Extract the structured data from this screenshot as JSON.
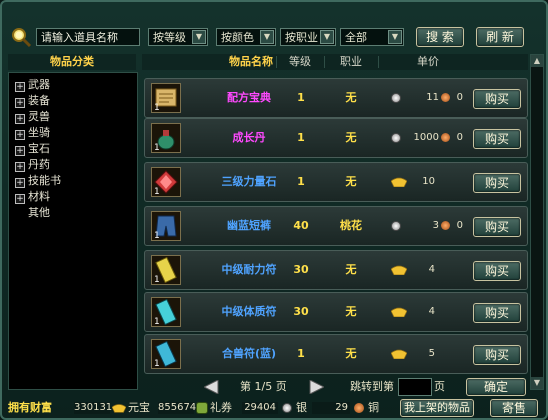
{
  "search": {
    "placeholder": "请输入道具名称"
  },
  "filters": {
    "level": "按等级",
    "color": "按颜色",
    "profession": "按职业",
    "scope": "全部"
  },
  "buttons": {
    "search": "搜 索",
    "refresh": "刷 新",
    "confirm": "确定",
    "my_listed": "我上架的物品",
    "sell": "寄售"
  },
  "category": {
    "header": "物品分类",
    "items": [
      {
        "label": "武器",
        "expand": "+"
      },
      {
        "label": "装备",
        "expand": "+"
      },
      {
        "label": "灵兽",
        "expand": "+"
      },
      {
        "label": "坐骑",
        "expand": "+"
      },
      {
        "label": "宝石",
        "expand": "+"
      },
      {
        "label": "丹药",
        "expand": "+"
      },
      {
        "label": "技能书",
        "expand": "+"
      },
      {
        "label": "材料",
        "expand": "+"
      },
      {
        "label": "其他",
        "expand": ""
      }
    ]
  },
  "table": {
    "headers": {
      "name": "物品名称",
      "level": "等级",
      "profession": "职业",
      "price": "单价"
    },
    "rows": [
      {
        "name": "配方宝典",
        "name_color": "#ff49ff",
        "level": "1",
        "profession": "无",
        "currency": "silver",
        "price_main": "11",
        "price_copper": "0",
        "count": "1",
        "icon": "scroll-book-icon"
      },
      {
        "name": "成长丹",
        "name_color": "#ff49ff",
        "level": "1",
        "profession": "无",
        "currency": "silver",
        "price_main": "1000",
        "price_copper": "0",
        "count": "1",
        "icon": "growth-pill-icon"
      },
      {
        "name": "三级力量石",
        "name_color": "#4fa3ff",
        "level": "1",
        "profession": "无",
        "currency": "yuanbao",
        "price_main": "10",
        "price_copper": "",
        "count": "1",
        "icon": "strength-stone-icon"
      },
      {
        "name": "幽蓝短裤",
        "name_color": "#4fa3ff",
        "level": "40",
        "profession": "桃花",
        "currency": "silver",
        "price_main": "3",
        "price_copper": "0",
        "count": "1",
        "icon": "blue-shorts-icon"
      },
      {
        "name": "中级耐力符",
        "name_color": "#4fa3ff",
        "level": "30",
        "profession": "无",
        "currency": "yuanbao",
        "price_main": "4",
        "price_copper": "",
        "count": "1",
        "icon": "endurance-talisman-icon"
      },
      {
        "name": "中级体质符",
        "name_color": "#4fa3ff",
        "level": "30",
        "profession": "无",
        "currency": "yuanbao",
        "price_main": "4",
        "price_copper": "",
        "count": "1",
        "icon": "constitution-talisman-icon"
      },
      {
        "name": "合兽符(蓝)",
        "name_color": "#4fa3ff",
        "level": "1",
        "profession": "无",
        "currency": "yuanbao",
        "price_main": "5",
        "price_copper": "",
        "count": "1",
        "icon": "beast-merge-talisman-icon"
      }
    ],
    "buy_label": "购买"
  },
  "pagination": {
    "page_prefix": "第",
    "page_text": "1/5",
    "page_suffix": "页",
    "jump_label": "跳转到第",
    "jump_suffix": "页"
  },
  "wealth": {
    "label": "拥有财富",
    "yuanbao_value": "330131",
    "yuanbao_label": "元宝",
    "coupon_value": "855674",
    "coupon_label": "礼券",
    "silver_value": "29404",
    "silver_label": "银",
    "copper_value": "29",
    "copper_label": "铜"
  },
  "colors": {
    "gold_text": "#ffd24a",
    "frame": "#3f6a5f"
  }
}
